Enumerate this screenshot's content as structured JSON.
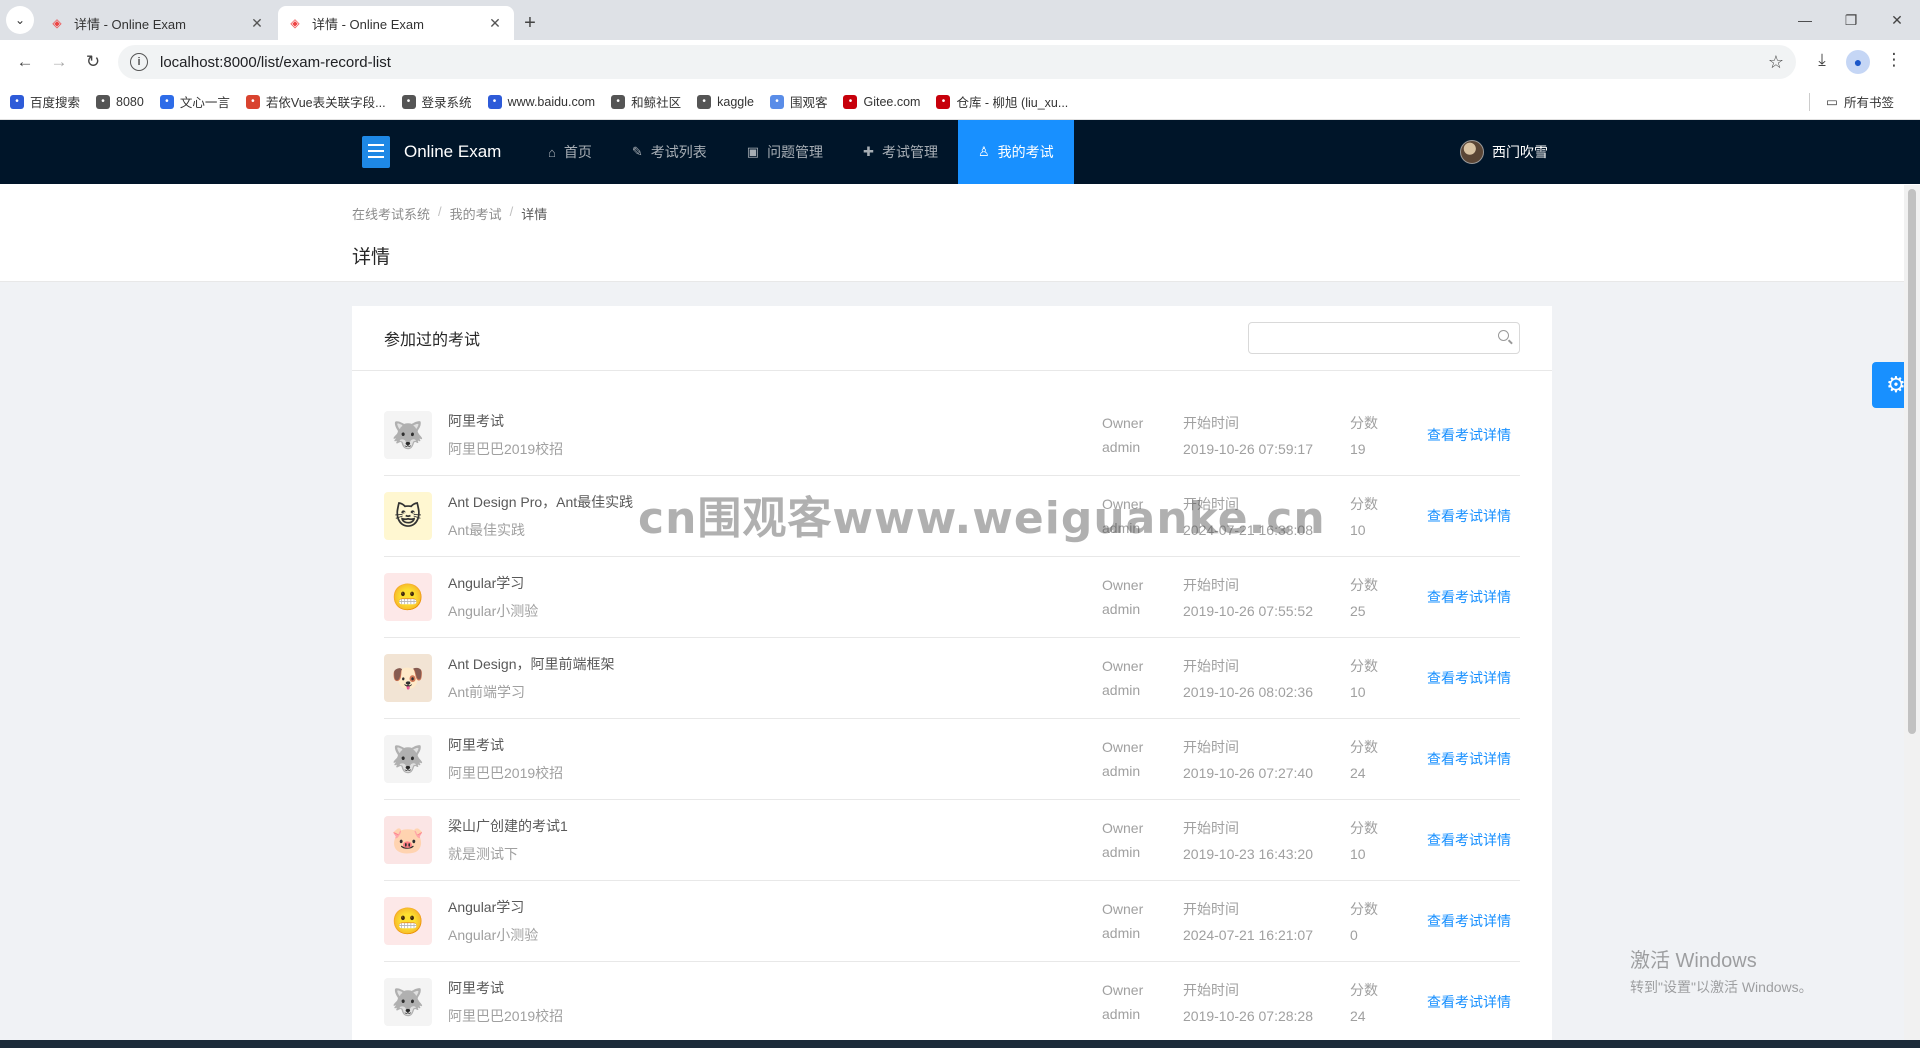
{
  "browser": {
    "tabs": [
      {
        "title": "详情 - Online Exam",
        "active": false
      },
      {
        "title": "详情 - Online Exam",
        "active": true
      }
    ],
    "url": "localhost:8000/list/exam-record-list",
    "bookmarks": [
      {
        "label": "百度搜索",
        "color": "#2e5bd8"
      },
      {
        "label": "8080",
        "color": "#555555"
      },
      {
        "label": "文心一言",
        "color": "#2e6ce8"
      },
      {
        "label": "若依Vue表关联字段...",
        "color": "#d9432f"
      },
      {
        "label": "登录系统",
        "color": "#555555"
      },
      {
        "label": "www.baidu.com",
        "color": "#2e5bd8"
      },
      {
        "label": "和鲸社区",
        "color": "#555555"
      },
      {
        "label": "kaggle",
        "color": "#555555"
      },
      {
        "label": "围观客",
        "color": "#5a8de8"
      },
      {
        "label": "Gitee.com",
        "color": "#c7000b"
      },
      {
        "label": "仓库 - 柳旭 (liu_xu...",
        "color": "#c7000b"
      }
    ],
    "bookmarks_folder": "所有书签"
  },
  "app": {
    "logo_text": "Online Exam",
    "menu": [
      {
        "label": "首页",
        "icon": "home-icon",
        "glyph": "⌂",
        "active": false
      },
      {
        "label": "考试列表",
        "icon": "list-icon",
        "glyph": "✎",
        "active": false
      },
      {
        "label": "问题管理",
        "icon": "question-icon",
        "glyph": "▣",
        "active": false
      },
      {
        "label": "考试管理",
        "icon": "manage-icon",
        "glyph": "✚",
        "active": false
      },
      {
        "label": "我的考试",
        "icon": "user-icon",
        "glyph": "♙",
        "active": true
      }
    ],
    "user_name": "西门吹雪",
    "accent": "#1890ff",
    "header_bg": "#001529"
  },
  "page": {
    "breadcrumb": [
      "在线考试系统",
      "我的考试",
      "详情"
    ],
    "title": "详情"
  },
  "card": {
    "title": "参加过的考试",
    "search_placeholder": ""
  },
  "records": [
    {
      "avatar": "fox",
      "title": "阿里考试",
      "desc": "阿里巴巴2019校招",
      "owner_label": "Owner",
      "owner": "admin",
      "time_label": "开始时间",
      "time": "2019-10-26 07:59:17",
      "score_label": "分数",
      "score": "19",
      "action": "查看考试详情"
    },
    {
      "avatar": "dora",
      "title": "Ant Design Pro，Ant最佳实践",
      "desc": "Ant最佳实践",
      "owner_label": "Owner",
      "owner": "admin",
      "time_label": "开始时间",
      "time": "2024-07-21 16:33:08",
      "score_label": "分数",
      "score": "10",
      "action": "查看考试详情"
    },
    {
      "avatar": "angular",
      "title": "Angular学习",
      "desc": "Angular小测验",
      "owner_label": "Owner",
      "owner": "admin",
      "time_label": "开始时间",
      "time": "2019-10-26 07:55:52",
      "score_label": "分数",
      "score": "25",
      "action": "查看考试详情"
    },
    {
      "avatar": "ant",
      "title": "Ant Design，阿里前端框架",
      "desc": "Ant前端学习",
      "owner_label": "Owner",
      "owner": "admin",
      "time_label": "开始时间",
      "time": "2019-10-26 08:02:36",
      "score_label": "分数",
      "score": "10",
      "action": "查看考试详情"
    },
    {
      "avatar": "fox",
      "title": "阿里考试",
      "desc": "阿里巴巴2019校招",
      "owner_label": "Owner",
      "owner": "admin",
      "time_label": "开始时间",
      "time": "2019-10-26 07:27:40",
      "score_label": "分数",
      "score": "24",
      "action": "查看考试详情"
    },
    {
      "avatar": "pig",
      "title": "梁山广创建的考试1",
      "desc": "就是测试下",
      "owner_label": "Owner",
      "owner": "admin",
      "time_label": "开始时间",
      "time": "2019-10-23 16:43:20",
      "score_label": "分数",
      "score": "10",
      "action": "查看考试详情"
    },
    {
      "avatar": "angular",
      "title": "Angular学习",
      "desc": "Angular小测验",
      "owner_label": "Owner",
      "owner": "admin",
      "time_label": "开始时间",
      "time": "2024-07-21 16:21:07",
      "score_label": "分数",
      "score": "0",
      "action": "查看考试详情"
    },
    {
      "avatar": "fox",
      "title": "阿里考试",
      "desc": "阿里巴巴2019校招",
      "owner_label": "Owner",
      "owner": "admin",
      "time_label": "开始时间",
      "time": "2019-10-26 07:28:28",
      "score_label": "分数",
      "score": "24",
      "action": "查看考试详情"
    }
  ],
  "watermark": "cn围观客www.weiguanke.cn",
  "os": {
    "activate_title": "激活 Windows",
    "activate_sub": "转到\"设置\"以激活 Windows。"
  }
}
